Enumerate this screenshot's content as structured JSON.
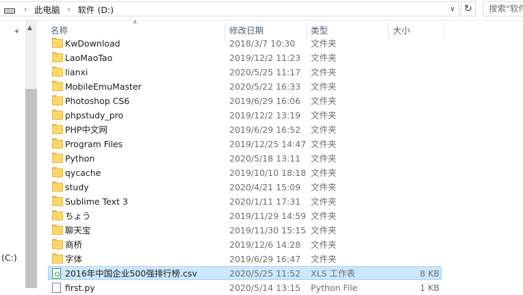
{
  "address": {
    "crumbs": [
      "此电脑",
      "软件 (D:)"
    ],
    "search_placeholder": "搜索\"软件"
  },
  "nav": {
    "drive_label": "(C:)"
  },
  "columns": {
    "name": "名称",
    "date": "修改日期",
    "type": "类型",
    "size": "大小"
  },
  "files": [
    {
      "name": "KwDownload",
      "date": "2018/3/7 10:30",
      "type": "文件夹",
      "size": "",
      "icon": "folder-icon"
    },
    {
      "name": "LaoMaoTao",
      "date": "2019/12/2 11:23",
      "type": "文件夹",
      "size": "",
      "icon": "folder-icon"
    },
    {
      "name": "lianxi",
      "date": "2020/5/25 11:17",
      "type": "文件夹",
      "size": "",
      "icon": "folder-icon"
    },
    {
      "name": "MobileEmuMaster",
      "date": "2020/5/22 16:33",
      "type": "文件夹",
      "size": "",
      "icon": "folder-icon"
    },
    {
      "name": "Photoshop CS6",
      "date": "2019/6/29 16:06",
      "type": "文件夹",
      "size": "",
      "icon": "folder-icon"
    },
    {
      "name": "phpstudy_pro",
      "date": "2019/12/2 13:19",
      "type": "文件夹",
      "size": "",
      "icon": "folder-icon"
    },
    {
      "name": "PHP中文网",
      "date": "2019/6/29 16:52",
      "type": "文件夹",
      "size": "",
      "icon": "folder-icon"
    },
    {
      "name": "Program Files",
      "date": "2019/12/25 14:47",
      "type": "文件夹",
      "size": "",
      "icon": "folder-icon"
    },
    {
      "name": "Python",
      "date": "2020/5/18 13:11",
      "type": "文件夹",
      "size": "",
      "icon": "folder-icon"
    },
    {
      "name": "qycache",
      "date": "2019/10/10 18:18",
      "type": "文件夹",
      "size": "",
      "icon": "folder-icon"
    },
    {
      "name": "study",
      "date": "2020/4/21 15:09",
      "type": "文件夹",
      "size": "",
      "icon": "folder-icon"
    },
    {
      "name": "Sublime Text 3",
      "date": "2020/1/11 17:31",
      "type": "文件夹",
      "size": "",
      "icon": "folder-icon"
    },
    {
      "name": "ちょう",
      "date": "2019/11/29 14:59",
      "type": "文件夹",
      "size": "",
      "icon": "folder-icon"
    },
    {
      "name": "聊天宝",
      "date": "2019/11/30 15:15",
      "type": "文件夹",
      "size": "",
      "icon": "folder-icon"
    },
    {
      "name": "商桥",
      "date": "2019/12/6 14:28",
      "type": "文件夹",
      "size": "",
      "icon": "folder-icon"
    },
    {
      "name": "字体",
      "date": "2019/6/29 16:47",
      "type": "文件夹",
      "size": "",
      "icon": "folder-icon"
    },
    {
      "name": "2016年中国企业500强排行榜.csv",
      "date": "2020/5/25 11:52",
      "type": "XLS 工作表",
      "size": "8 KB",
      "icon": "spreadsheet-file-icon",
      "selected": true
    },
    {
      "name": "first.py",
      "date": "2020/5/14 13:15",
      "type": "Python File",
      "size": "1 KB",
      "icon": "python-file-icon"
    }
  ]
}
